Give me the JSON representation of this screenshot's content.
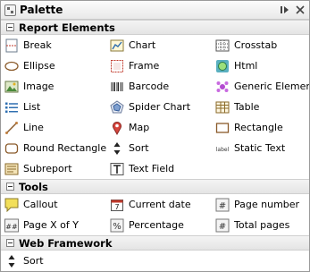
{
  "window": {
    "title": "Palette"
  },
  "sections": [
    {
      "label": "Report Elements",
      "items": [
        {
          "label": "Break",
          "icon": "break-icon"
        },
        {
          "label": "Chart",
          "icon": "chart-icon"
        },
        {
          "label": "Crosstab",
          "icon": "crosstab-icon"
        },
        {
          "label": "Ellipse",
          "icon": "ellipse-icon"
        },
        {
          "label": "Frame",
          "icon": "frame-icon"
        },
        {
          "label": "Html",
          "icon": "html-icon"
        },
        {
          "label": "Image",
          "icon": "image-icon"
        },
        {
          "label": "Barcode",
          "icon": "barcode-icon"
        },
        {
          "label": "Generic Element",
          "icon": "generic-element-icon"
        },
        {
          "label": "List",
          "icon": "list-icon"
        },
        {
          "label": "Spider Chart",
          "icon": "spider-chart-icon"
        },
        {
          "label": "Table",
          "icon": "table-icon"
        },
        {
          "label": "Line",
          "icon": "line-icon"
        },
        {
          "label": "Map",
          "icon": "map-icon"
        },
        {
          "label": "Rectangle",
          "icon": "rectangle-icon"
        },
        {
          "label": "Round Rectangle",
          "icon": "round-rectangle-icon"
        },
        {
          "label": "Sort",
          "icon": "sort-icon"
        },
        {
          "label": "Static Text",
          "icon": "static-text-icon"
        },
        {
          "label": "Subreport",
          "icon": "subreport-icon"
        },
        {
          "label": "Text Field",
          "icon": "text-field-icon"
        }
      ]
    },
    {
      "label": "Tools",
      "items": [
        {
          "label": "Callout",
          "icon": "callout-icon"
        },
        {
          "label": "Current date",
          "icon": "calendar-icon"
        },
        {
          "label": "Page number",
          "icon": "hash-icon"
        },
        {
          "label": "Page X of Y",
          "icon": "page-x-of-y-icon"
        },
        {
          "label": "Percentage",
          "icon": "percentage-icon"
        },
        {
          "label": "Total pages",
          "icon": "hash-icon"
        }
      ]
    },
    {
      "label": "Web Framework",
      "items": [
        {
          "label": "Sort",
          "icon": "sort-icon"
        }
      ]
    }
  ],
  "static_text_icon_label": "label"
}
